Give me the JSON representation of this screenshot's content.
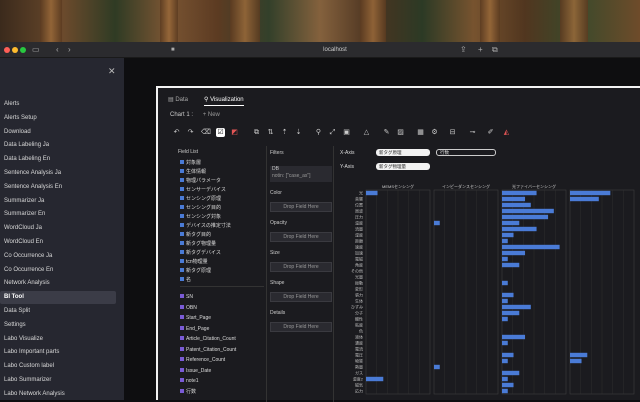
{
  "browser": {
    "url": "localhost"
  },
  "sidebar": {
    "items": [
      "Alerts",
      "Alerts Setup",
      "Download",
      "Data Labeling Ja",
      "Data Labeling En",
      "Sentence Analysis Ja",
      "Sentence Analysis En",
      "Summarizer Ja",
      "Summarizer En",
      "WordCloud Ja",
      "WordCloud En",
      "Co Occurrence Ja",
      "Co Occurrence En",
      "Network Analysis",
      "BI Tool",
      "Data Split",
      "Settings",
      "Labo Visualize",
      "Labo Important parts",
      "Labo Custom label",
      "Labo Summarizer",
      "Labo Network Analysis"
    ],
    "active_index": 14
  },
  "tabs": {
    "data": "Data",
    "visualization": "Visualization"
  },
  "chart_row": {
    "label": "Chart 1 :",
    "add": "+ New"
  },
  "field_list": {
    "title": "Field List",
    "dimensions": [
      "対象層",
      "生体情報",
      "物理パラメータ",
      "センサーデバイス",
      "センシング原理",
      "センシング目的",
      "センシング対象",
      "デバイスの推定寸法",
      "新タグ目的",
      "新タグ物理量",
      "新タグデバイス",
      "tcn物理量",
      "新タグ原理",
      "名"
    ],
    "measures": [
      "SN",
      "OBN",
      "Start_Page",
      "End_Page",
      "Article_Citation_Count",
      "Patent_Citation_Count",
      "Reference_Count",
      "Issue_Date",
      "note1",
      "行数"
    ]
  },
  "encodings": {
    "filters": "Filters",
    "filter_field": "DB",
    "filter_value": "notin: [\"case_as\"]",
    "color": "Color",
    "opacity": "Opacity",
    "size": "Size",
    "shape": "Shape",
    "details": "Details",
    "drop": "Drop Field Here"
  },
  "axes": {
    "x_label": "X-Axis",
    "x_field": "新タグ原理",
    "x_extra": "行数",
    "y_label": "Y-Axis",
    "y_field": "新タグ物理量"
  },
  "chart_data": {
    "type": "bar",
    "facets": [
      "MEMSセンシング",
      "インピーダンスセンシング",
      "光ファイバーセンシング",
      ""
    ],
    "categories": [
      "光",
      "音響",
      "位置",
      "周波",
      "圧力",
      "温度",
      "流量",
      "湿度",
      "距離",
      "速度",
      "加速",
      "電磁",
      "角度",
      "その他",
      "光量",
      "振動",
      "変形",
      "張力",
      "生体",
      "ひずみ",
      "分子",
      "酸性",
      "粘度",
      "色",
      "液体",
      "濃度",
      "電流",
      "電圧",
      "物質",
      "熱量",
      "ガス",
      "湿度2",
      "磁気",
      "応力"
    ],
    "series": [
      {
        "values": [
          2,
          0,
          0,
          0,
          0,
          0,
          0,
          0,
          0,
          0,
          0,
          0,
          0,
          0,
          0,
          0,
          0,
          0,
          0,
          0,
          0,
          0,
          0,
          0,
          0,
          0,
          0,
          0,
          0,
          0,
          0,
          3,
          0,
          0
        ]
      },
      {
        "values": [
          0,
          0,
          0,
          0,
          0,
          1,
          0,
          0,
          0,
          0,
          0,
          0,
          0,
          0,
          0,
          0,
          0,
          0,
          0,
          0,
          0,
          0,
          0,
          0,
          0,
          0,
          0,
          0,
          0,
          1,
          0,
          0,
          0,
          0
        ]
      },
      {
        "values": [
          6,
          4,
          5,
          9,
          8,
          3,
          6,
          2,
          1,
          10,
          4,
          1,
          3,
          0,
          0,
          1,
          0,
          2,
          1,
          5,
          3,
          1,
          0,
          0,
          4,
          1,
          0,
          2,
          1,
          0,
          3,
          1,
          2,
          1
        ]
      },
      {
        "values": [
          7,
          5,
          0,
          0,
          0,
          0,
          0,
          0,
          0,
          0,
          0,
          0,
          0,
          0,
          0,
          0,
          0,
          0,
          0,
          0,
          0,
          0,
          0,
          0,
          0,
          0,
          0,
          3,
          2,
          0,
          0,
          0,
          0,
          0
        ]
      }
    ]
  }
}
